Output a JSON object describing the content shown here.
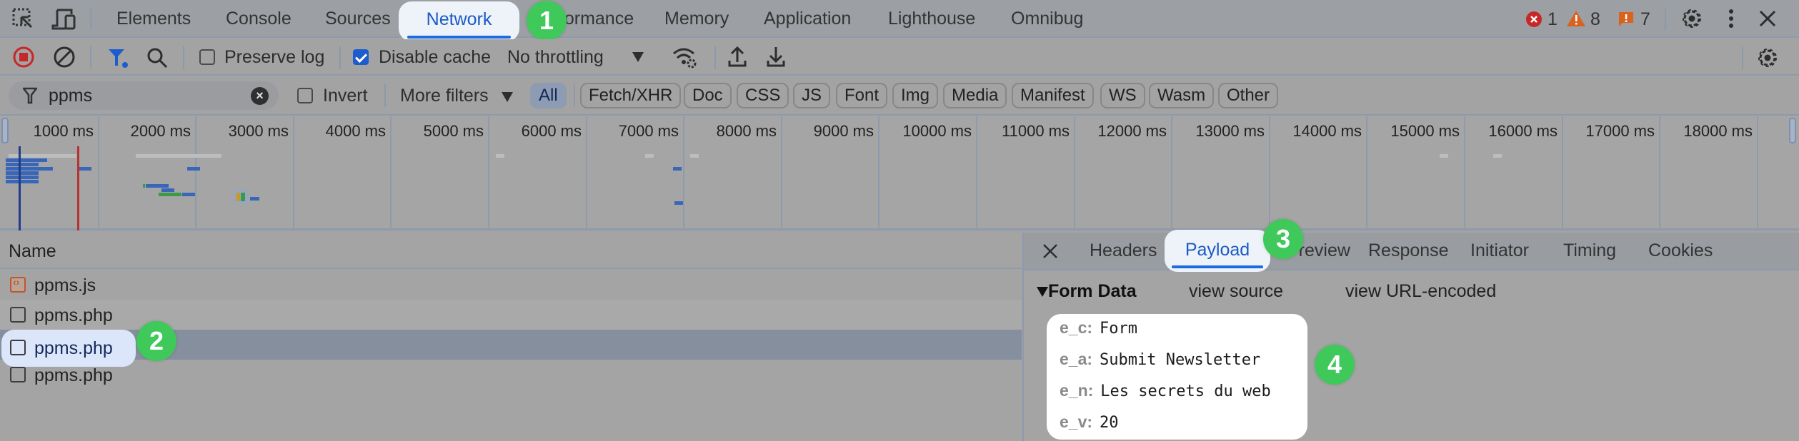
{
  "tabbar": {
    "tabs": [
      {
        "label": "Elements"
      },
      {
        "label": "Console"
      },
      {
        "label": "Sources"
      },
      {
        "label": "Network",
        "active": true
      },
      {
        "label": "Performance"
      },
      {
        "label": "Memory"
      },
      {
        "label": "Application"
      },
      {
        "label": "Lighthouse"
      },
      {
        "label": "Omnibug"
      }
    ],
    "counters": {
      "errors": "1",
      "warnings": "8",
      "issues": "7"
    },
    "icons": [
      "inspect-element-icon",
      "device-toolbar-icon",
      "settings-icon",
      "more-options-icon",
      "close-icon"
    ]
  },
  "toolbar": {
    "preserve_log": {
      "label": "Preserve log",
      "checked": false
    },
    "disable_cache": {
      "label": "Disable cache",
      "checked": true
    },
    "throttling": "No throttling",
    "icons": [
      "record-stop-icon",
      "clear-icon",
      "filter-icon",
      "search-icon",
      "network-conditions-icon",
      "import-har-icon",
      "export-har-icon",
      "network-settings-icon"
    ]
  },
  "filter": {
    "search_value": "ppms",
    "invert_label": "Invert",
    "invert_checked": false,
    "more_filters": "More filters",
    "types": [
      "All",
      "Fetch/XHR",
      "Doc",
      "CSS",
      "JS",
      "Font",
      "Img",
      "Media",
      "Manifest",
      "WS",
      "Wasm",
      "Other"
    ],
    "active_type": "All"
  },
  "timeline": {
    "ticks": [
      "1000 ms",
      "2000 ms",
      "3000 ms",
      "4000 ms",
      "5000 ms",
      "6000 ms",
      "7000 ms",
      "8000 ms",
      "9000 ms",
      "10000 ms",
      "11000 ms",
      "12000 ms",
      "13000 ms",
      "14000 ms",
      "15000 ms",
      "16000 ms",
      "17000 ms",
      "18000 ms"
    ]
  },
  "requests": {
    "column_name": "Name",
    "rows": [
      {
        "name": "ppms.js",
        "type": "script"
      },
      {
        "name": "ppms.php",
        "type": "other"
      },
      {
        "name": "ppms.php",
        "type": "other",
        "selected": true
      },
      {
        "name": "ppms.php",
        "type": "other"
      }
    ]
  },
  "details": {
    "tabs": [
      "Headers",
      "Payload",
      "Preview",
      "Response",
      "Initiator",
      "Timing",
      "Cookies"
    ],
    "active_tab": "Payload",
    "section_title": "Form Data",
    "view_source": "view source",
    "view_url_encoded": "view URL-encoded",
    "form_data": [
      {
        "key": "e_c:",
        "value": "Form"
      },
      {
        "key": "e_a:",
        "value": "Submit Newsletter"
      },
      {
        "key": "e_n:",
        "value": "Les secrets du web"
      },
      {
        "key": "e_v:",
        "value": "20"
      }
    ]
  },
  "annotations": [
    "1",
    "2",
    "3",
    "4"
  ],
  "colors": {
    "accent": "#1a5bc4",
    "badge": "#3ec95a",
    "error": "#c62828",
    "warning": "#d9631e",
    "selected_row": "#868f9e"
  }
}
